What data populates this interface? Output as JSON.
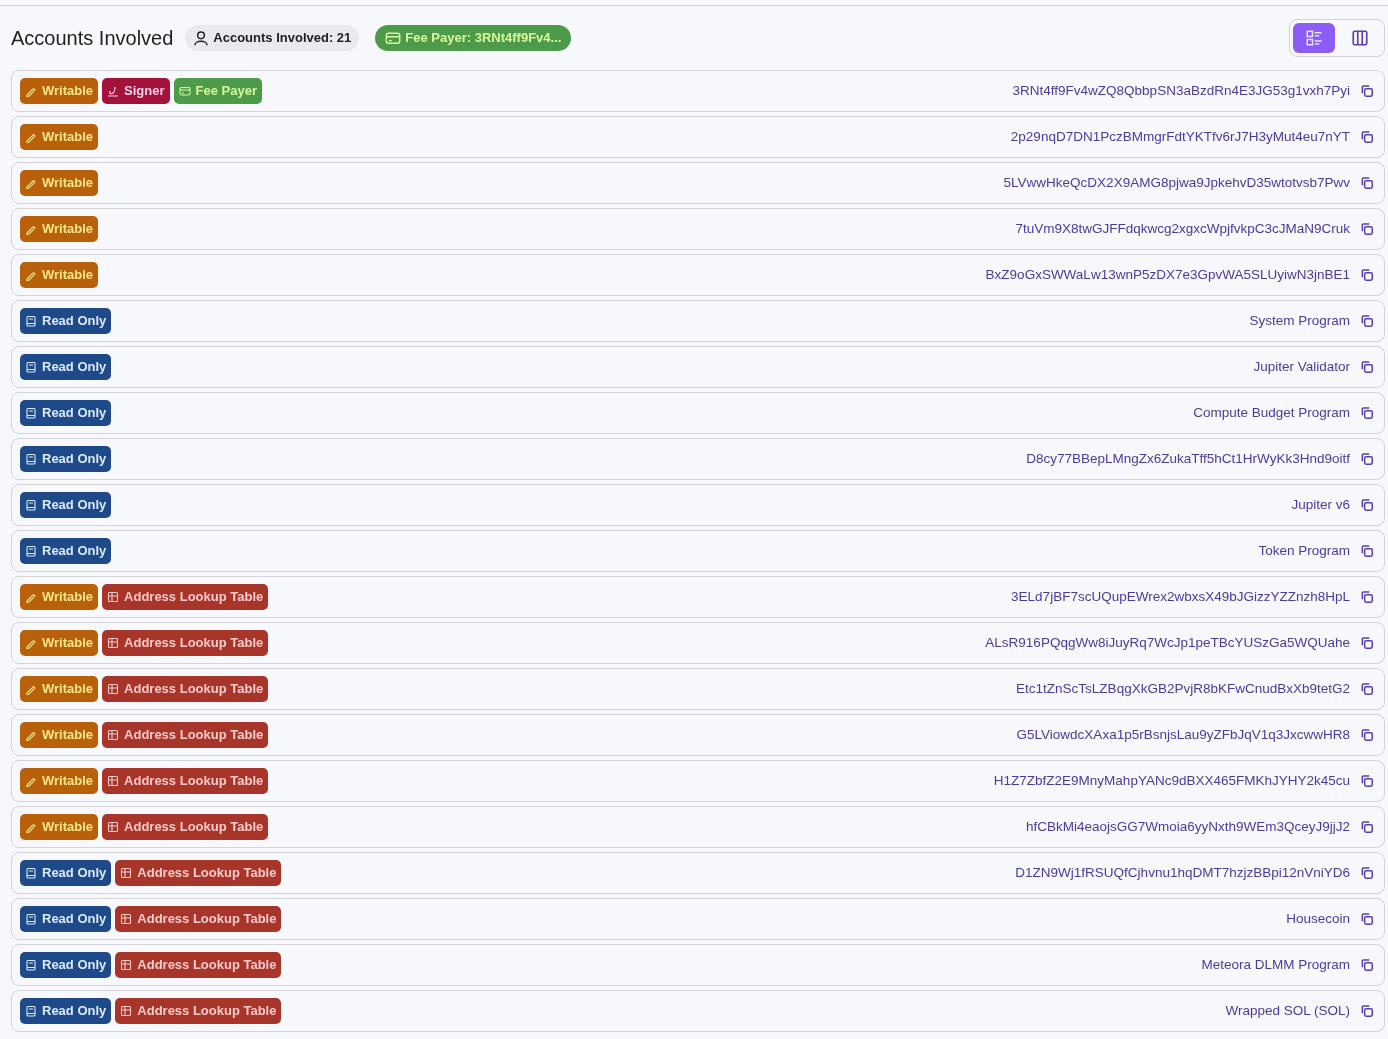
{
  "header": {
    "title": "Accounts Involved",
    "count_badge": "Accounts Involved: 21",
    "fee_payer_badge": "Fee Payer: 3RNt4ff9Fv4...",
    "view_toggle": [
      {
        "kind": "list",
        "selected": true
      },
      {
        "kind": "columns",
        "selected": false
      }
    ]
  },
  "accounts": [
    {
      "tags": [
        {
          "kind": "writable",
          "label": "Writable"
        },
        {
          "kind": "signer",
          "label": "Signer"
        },
        {
          "kind": "fee_payer",
          "label": "Fee Payer"
        }
      ],
      "address": "3RNt4ff9Fv4wZQ8QbbpSN3aBzdRn4E3JG53g1vxh7Pyi"
    },
    {
      "tags": [
        {
          "kind": "writable",
          "label": "Writable"
        }
      ],
      "address": "2p29nqD7DN1PczBMmgrFdtYKTfv6rJ7H3yMut4eu7nYT"
    },
    {
      "tags": [
        {
          "kind": "writable",
          "label": "Writable"
        }
      ],
      "address": "5LVwwHkeQcDX2X9AMG8pjwa9JpkehvD35wtotvsb7Pwv"
    },
    {
      "tags": [
        {
          "kind": "writable",
          "label": "Writable"
        }
      ],
      "address": "7tuVm9X8twGJFFdqkwcg2xgxcWpjfvkpC3cJMaN9Cruk"
    },
    {
      "tags": [
        {
          "kind": "writable",
          "label": "Writable"
        }
      ],
      "address": "BxZ9oGxSWWaLw13wnP5zDX7e3GpvWA5SLUyiwN3jnBE1"
    },
    {
      "tags": [
        {
          "kind": "readonly",
          "label": "Read Only"
        }
      ],
      "address": "System Program"
    },
    {
      "tags": [
        {
          "kind": "readonly",
          "label": "Read Only"
        }
      ],
      "address": "Jupiter Validator"
    },
    {
      "tags": [
        {
          "kind": "readonly",
          "label": "Read Only"
        }
      ],
      "address": "Compute Budget Program"
    },
    {
      "tags": [
        {
          "kind": "readonly",
          "label": "Read Only"
        }
      ],
      "address": "D8cy77BBepLMngZx6ZukaTff5hCt1HrWyKk3Hnd9oitf"
    },
    {
      "tags": [
        {
          "kind": "readonly",
          "label": "Read Only"
        }
      ],
      "address": "Jupiter v6"
    },
    {
      "tags": [
        {
          "kind": "readonly",
          "label": "Read Only"
        }
      ],
      "address": "Token Program"
    },
    {
      "tags": [
        {
          "kind": "writable",
          "label": "Writable"
        },
        {
          "kind": "lookup",
          "label": "Address Lookup Table"
        }
      ],
      "address": "3ELd7jBF7scUQupEWrex2wbxsX49bJGizzYZZnzh8HpL"
    },
    {
      "tags": [
        {
          "kind": "writable",
          "label": "Writable"
        },
        {
          "kind": "lookup",
          "label": "Address Lookup Table"
        }
      ],
      "address": "ALsR916PQqgWw8iJuyRq7WcJp1peTBcYUSzGa5WQUahe"
    },
    {
      "tags": [
        {
          "kind": "writable",
          "label": "Writable"
        },
        {
          "kind": "lookup",
          "label": "Address Lookup Table"
        }
      ],
      "address": "Etc1tZnScTsLZBqgXkGB2PvjR8bKFwCnudBxXb9tetG2"
    },
    {
      "tags": [
        {
          "kind": "writable",
          "label": "Writable"
        },
        {
          "kind": "lookup",
          "label": "Address Lookup Table"
        }
      ],
      "address": "G5LViowdcXAxa1p5rBsnjsLau9yZFbJqV1q3JxcwwHR8"
    },
    {
      "tags": [
        {
          "kind": "writable",
          "label": "Writable"
        },
        {
          "kind": "lookup",
          "label": "Address Lookup Table"
        }
      ],
      "address": "H1Z7ZbfZ2E9MnyMahpYANc9dBXX465FMKhJYHY2k45cu"
    },
    {
      "tags": [
        {
          "kind": "writable",
          "label": "Writable"
        },
        {
          "kind": "lookup",
          "label": "Address Lookup Table"
        }
      ],
      "address": "hfCBkMi4eaojsGG7Wmoia6yyNxth9WEm3QceyJ9jjJ2"
    },
    {
      "tags": [
        {
          "kind": "readonly",
          "label": "Read Only"
        },
        {
          "kind": "lookup",
          "label": "Address Lookup Table"
        }
      ],
      "address": "D1ZN9Wj1fRSUQfCjhvnu1hqDMT7hzjzBBpi12nVniYD6"
    },
    {
      "tags": [
        {
          "kind": "readonly",
          "label": "Read Only"
        },
        {
          "kind": "lookup",
          "label": "Address Lookup Table"
        }
      ],
      "address": "Housecoin"
    },
    {
      "tags": [
        {
          "kind": "readonly",
          "label": "Read Only"
        },
        {
          "kind": "lookup",
          "label": "Address Lookup Table"
        }
      ],
      "address": "Meteora DLMM Program"
    },
    {
      "tags": [
        {
          "kind": "readonly",
          "label": "Read Only"
        },
        {
          "kind": "lookup",
          "label": "Address Lookup Table"
        }
      ],
      "address": "Wrapped SOL (SOL)"
    }
  ]
}
